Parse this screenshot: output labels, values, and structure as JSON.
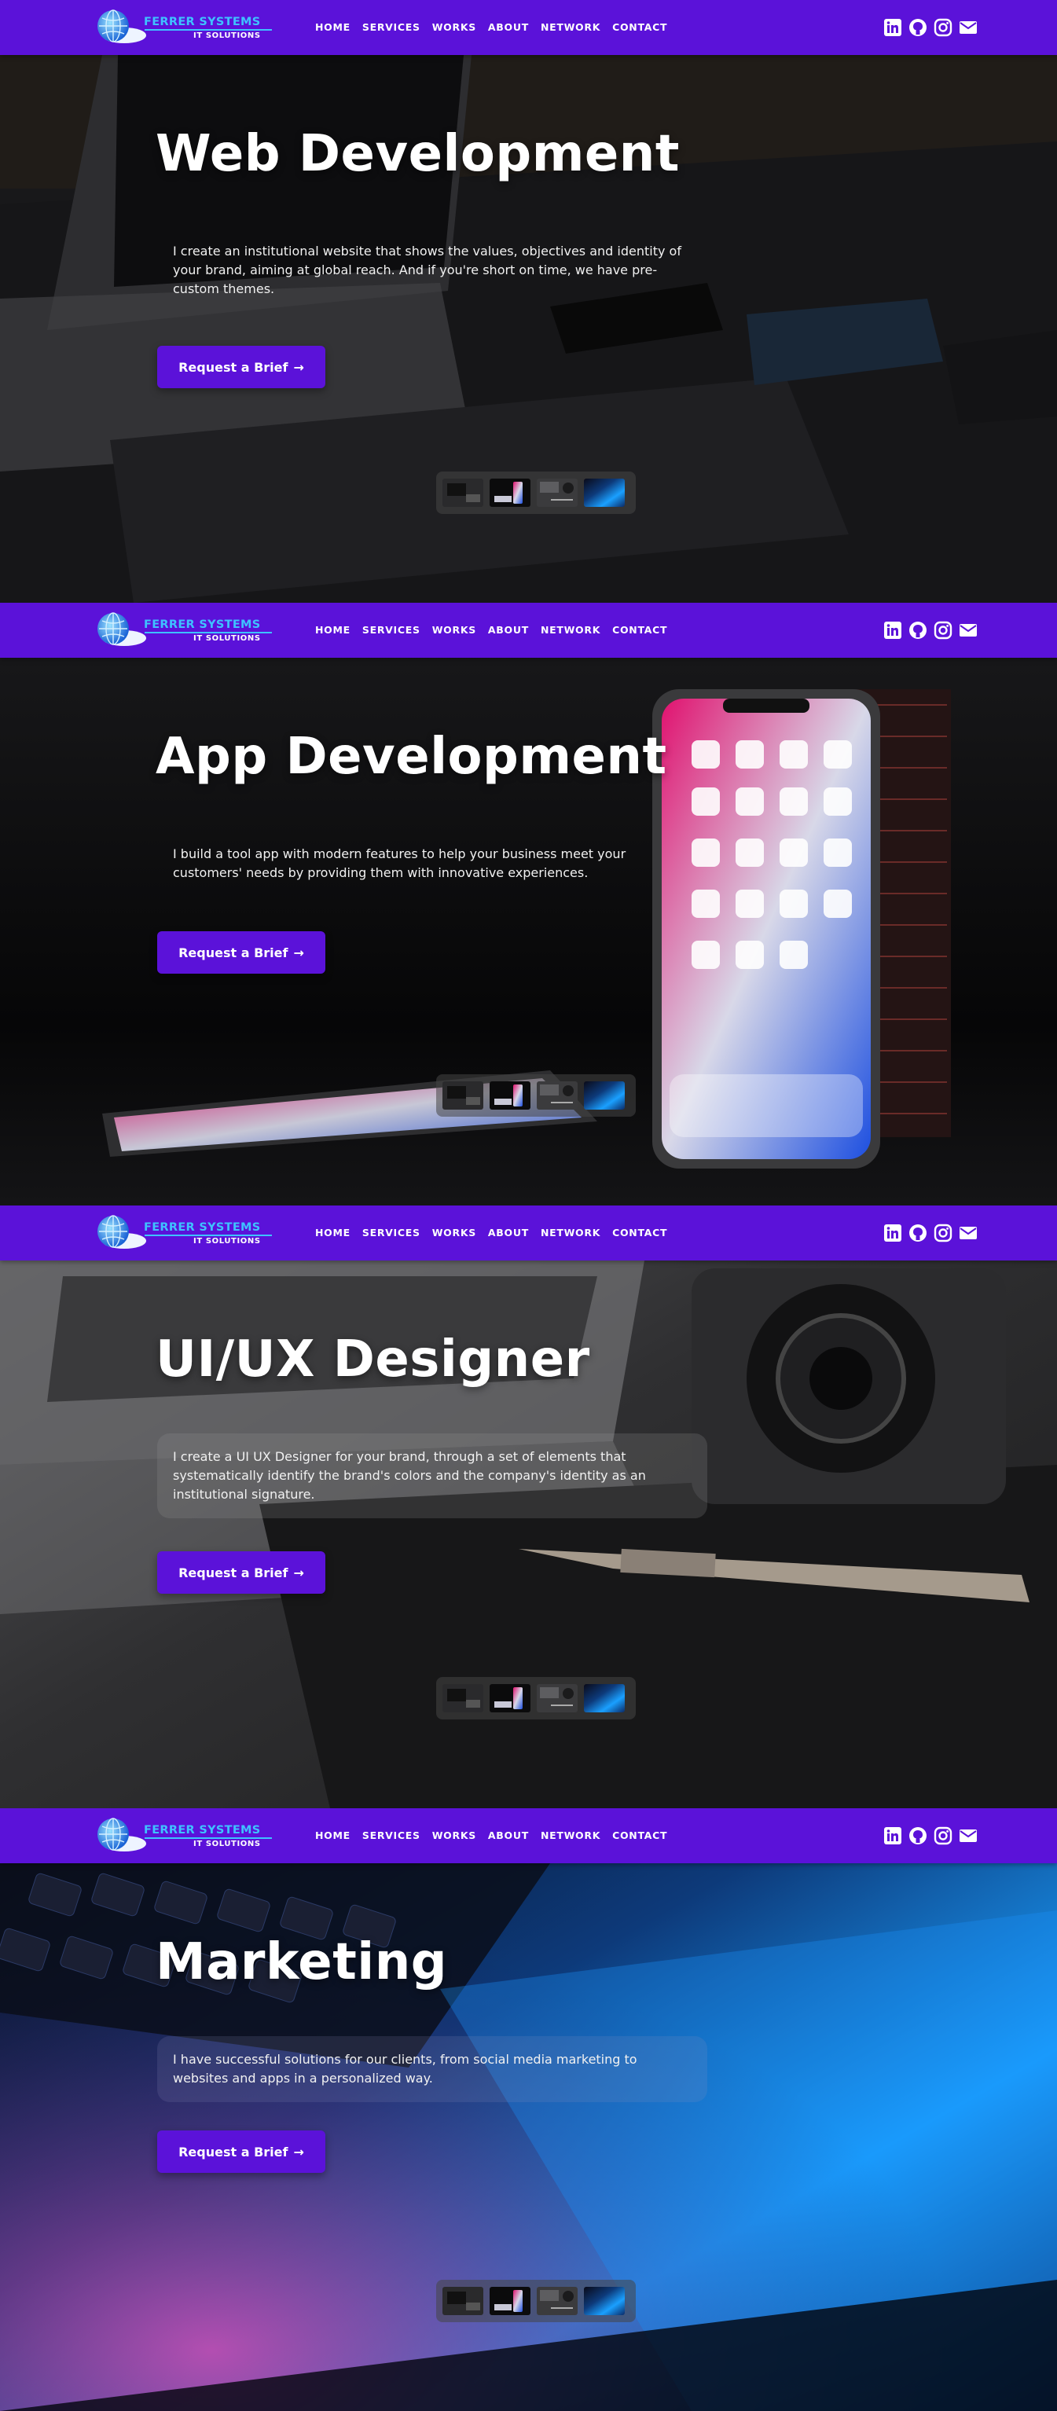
{
  "brand": {
    "name": "FERRER SYSTEMS",
    "tagline": "IT SOLUTIONS",
    "accent_color": "#5b12d9",
    "logo_text_color": "#3ec2ff"
  },
  "nav": {
    "items": [
      {
        "label": "HOME"
      },
      {
        "label": "SERVICES"
      },
      {
        "label": "WORKS"
      },
      {
        "label": "ABOUT"
      },
      {
        "label": "NETWORK"
      },
      {
        "label": "CONTACT"
      }
    ],
    "socials": [
      {
        "icon": "linkedin-icon"
      },
      {
        "icon": "github-icon"
      },
      {
        "icon": "instagram-icon"
      },
      {
        "icon": "email-icon"
      }
    ]
  },
  "slides": [
    {
      "title": "Web Development",
      "description": "I create an institutional website that shows the values, objectives and identity of your brand, aiming at global reach. And if you're short on time, we have pre-custom themes.",
      "button_label": "Request a Brief",
      "background": "laptop-and-devices-photo"
    },
    {
      "title": "App Development",
      "description": "I build a tool app with modern features to help your business meet your customers' needs by providing them with innovative experiences.",
      "button_label": "Request a Brief",
      "background": "smartphones-photo"
    },
    {
      "title": "UI/UX Designer",
      "description": "I create a UI UX Designer for your brand, through a set of elements that systematically identify the brand's colors and the company's identity as an institutional signature.",
      "button_label": "Request a Brief",
      "background": "laptop-camera-pen-photo"
    },
    {
      "title": "Marketing",
      "description": "I have successful solutions for our clients, from social media marketing to websites and apps in a personalized way.",
      "button_label": "Request a Brief",
      "background": "keyboard-blue-light-photo"
    }
  ]
}
